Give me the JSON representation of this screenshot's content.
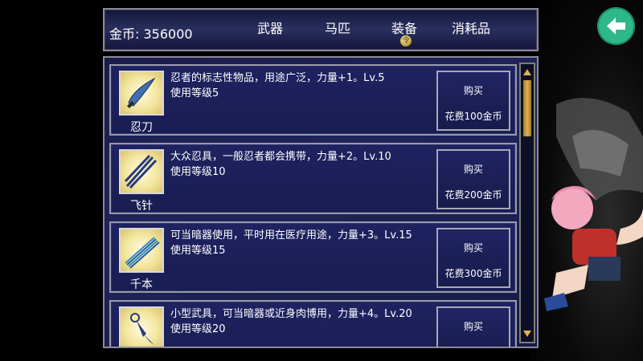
{
  "header": {
    "coins_label": "金币: 356000",
    "tabs": [
      {
        "label": "武器"
      },
      {
        "label": "马匹"
      },
      {
        "label": "装备"
      },
      {
        "label": "消耗品"
      }
    ],
    "tab_badge": "令"
  },
  "items": [
    {
      "name": "忍刀",
      "desc_line1": "忍者的标志性物品，用途广泛，力量+1。Lv.5",
      "desc_line2": "使用等级5",
      "buy": "购买",
      "cost": "花费100金币",
      "icon": "ninja-sword-icon"
    },
    {
      "name": "飞针",
      "desc_line1": "大众忍具，一般忍者都会携带，力量+2。Lv.10",
      "desc_line2": "使用等级10",
      "buy": "购买",
      "cost": "花费200金币",
      "icon": "flying-needles-icon"
    },
    {
      "name": "千本",
      "desc_line1": "可当暗器使用，平时用在医疗用途，力量+3。Lv.15",
      "desc_line2": "使用等级15",
      "buy": "购买",
      "cost": "花费300金币",
      "icon": "senbon-icon"
    },
    {
      "name": "",
      "desc_line1": "小型武具，可当暗器或近身肉博用，力量+4。Lv.20",
      "desc_line2": "使用等级20",
      "buy": "购买",
      "cost": "",
      "icon": "kunai-icon"
    }
  ],
  "colors": {
    "panel": "#1e2260",
    "back_button": "#2eb88a",
    "scroll_thumb": "#e0b050"
  }
}
